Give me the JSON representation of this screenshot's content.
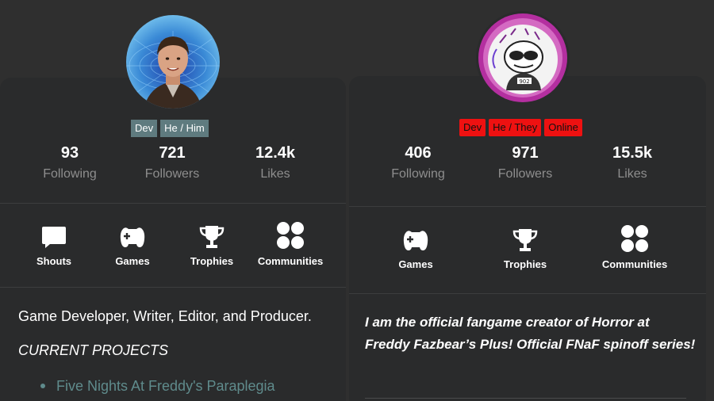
{
  "left_profile": {
    "badges": [
      "Dev",
      "He / Him"
    ],
    "stats": [
      {
        "value": "93",
        "label": "Following"
      },
      {
        "value": "721",
        "label": "Followers"
      },
      {
        "value": "12.4k",
        "label": "Likes"
      }
    ],
    "nav": [
      {
        "label": "Shouts",
        "icon": "speech-bubble-icon"
      },
      {
        "label": "Games",
        "icon": "gamepad-icon"
      },
      {
        "label": "Trophies",
        "icon": "trophy-icon"
      },
      {
        "label": "Communities",
        "icon": "four-dots-icon"
      }
    ],
    "bio": {
      "line1": "Game Developer, Writer, Editor, and Producer.",
      "heading": "CURRENT PROJECTS",
      "projects": [
        "Five Nights At Freddy's Paraplegia"
      ]
    }
  },
  "right_profile": {
    "badges": [
      "Dev",
      "He / They",
      "Online"
    ],
    "stats": [
      {
        "value": "406",
        "label": "Following"
      },
      {
        "value": "971",
        "label": "Followers"
      },
      {
        "value": "15.5k",
        "label": "Likes"
      }
    ],
    "nav": [
      {
        "label": "Games",
        "icon": "gamepad-icon"
      },
      {
        "label": "Trophies",
        "icon": "trophy-icon"
      },
      {
        "label": "Communities",
        "icon": "four-dots-icon"
      }
    ],
    "bio": {
      "text": "I am the official fangame creator of Horror at Freddy Fazbear’s Plus! Official FNaF spinoff series!"
    }
  },
  "colors": {
    "background": "#2f2f2f",
    "card": "#2a2b2c",
    "badge_gray": "#5f7b7f",
    "badge_red": "#ee1111",
    "link": "#5f8b8c",
    "muted": "#8e8e8e"
  }
}
